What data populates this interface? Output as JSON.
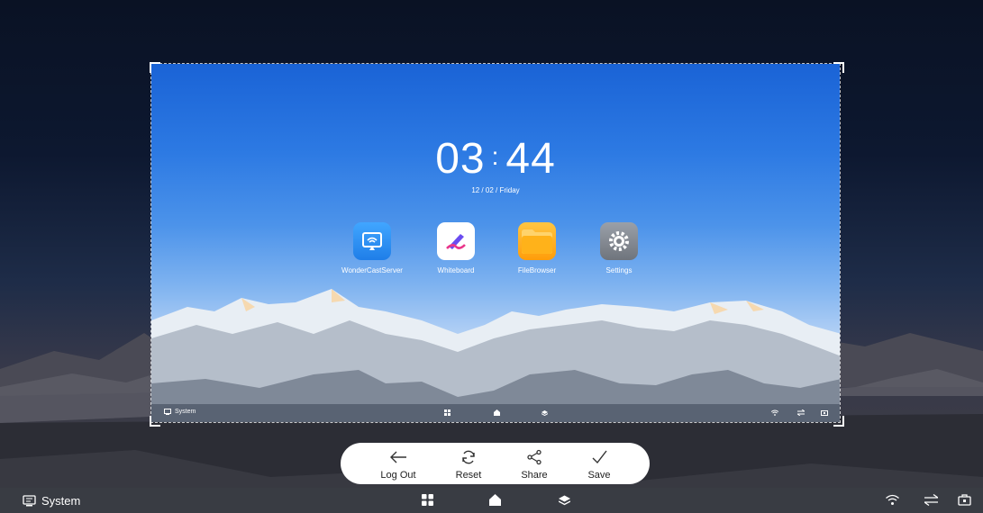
{
  "inner_screen": {
    "clock": {
      "hours": "03",
      "separator": ":",
      "minutes": "44"
    },
    "date": "12 / 02 / Friday",
    "apps": [
      {
        "label": "WonderCastServer",
        "icon": "cast-icon",
        "color": "#2a8bf2"
      },
      {
        "label": "Whiteboard",
        "icon": "whiteboard-pen-icon",
        "color": "#ffffff"
      },
      {
        "label": "FileBrowser",
        "icon": "folder-icon",
        "color": "#ffb41c"
      },
      {
        "label": "Settings",
        "icon": "gear-icon",
        "color": "#8a8f98"
      }
    ],
    "taskbar": {
      "system_label": "System"
    }
  },
  "toolbar": {
    "buttons": [
      {
        "label": "Log Out",
        "icon": "arrow-left-icon"
      },
      {
        "label": "Reset",
        "icon": "refresh-icon"
      },
      {
        "label": "Share",
        "icon": "share-icon"
      },
      {
        "label": "Save",
        "icon": "checkmark-icon"
      }
    ]
  },
  "taskbar": {
    "system_label": "System",
    "icons": [
      "apps-grid-icon",
      "home-icon",
      "layers-icon",
      "wifi-icon",
      "transfer-icon",
      "toolbox-icon"
    ]
  }
}
